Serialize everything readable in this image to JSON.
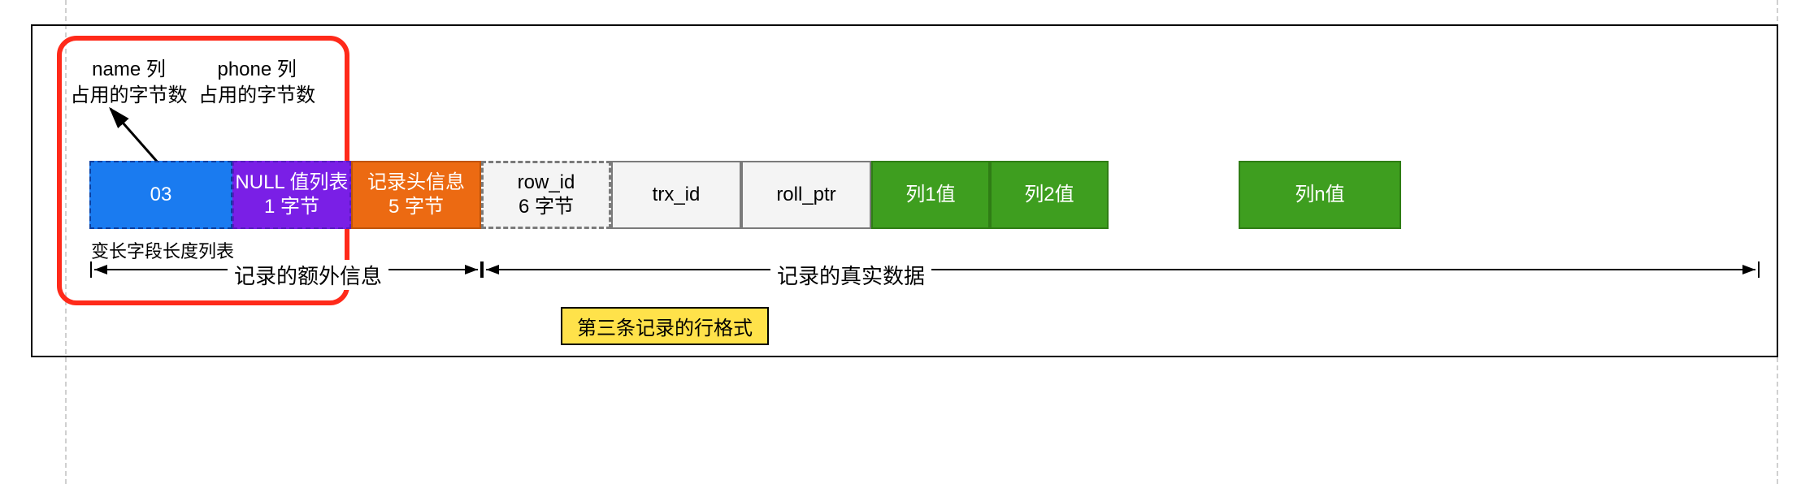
{
  "annotations": {
    "name_col": {
      "line1": "name 列",
      "line2": "占用的字节数"
    },
    "phone_col": {
      "line1": "phone 列",
      "line2": "占用的字节数"
    }
  },
  "cells": {
    "varlen": {
      "label": "03"
    },
    "null": {
      "line1": "NULL 值列表",
      "line2": "1 字节"
    },
    "header": {
      "line1": "记录头信息",
      "line2": "5 字节"
    },
    "rowid": {
      "line1": "row_id",
      "line2": "6 字节"
    },
    "trx": {
      "label": "trx_id"
    },
    "roll": {
      "label": "roll_ptr"
    },
    "col1": {
      "label": "列1值"
    },
    "col2": {
      "label": "列2值"
    },
    "coln": {
      "label": "列n值"
    }
  },
  "sublabel": "变长字段长度列表",
  "ranges": {
    "extra": "记录的额外信息",
    "real": "记录的真实数据"
  },
  "caption": "第三条记录的行格式"
}
